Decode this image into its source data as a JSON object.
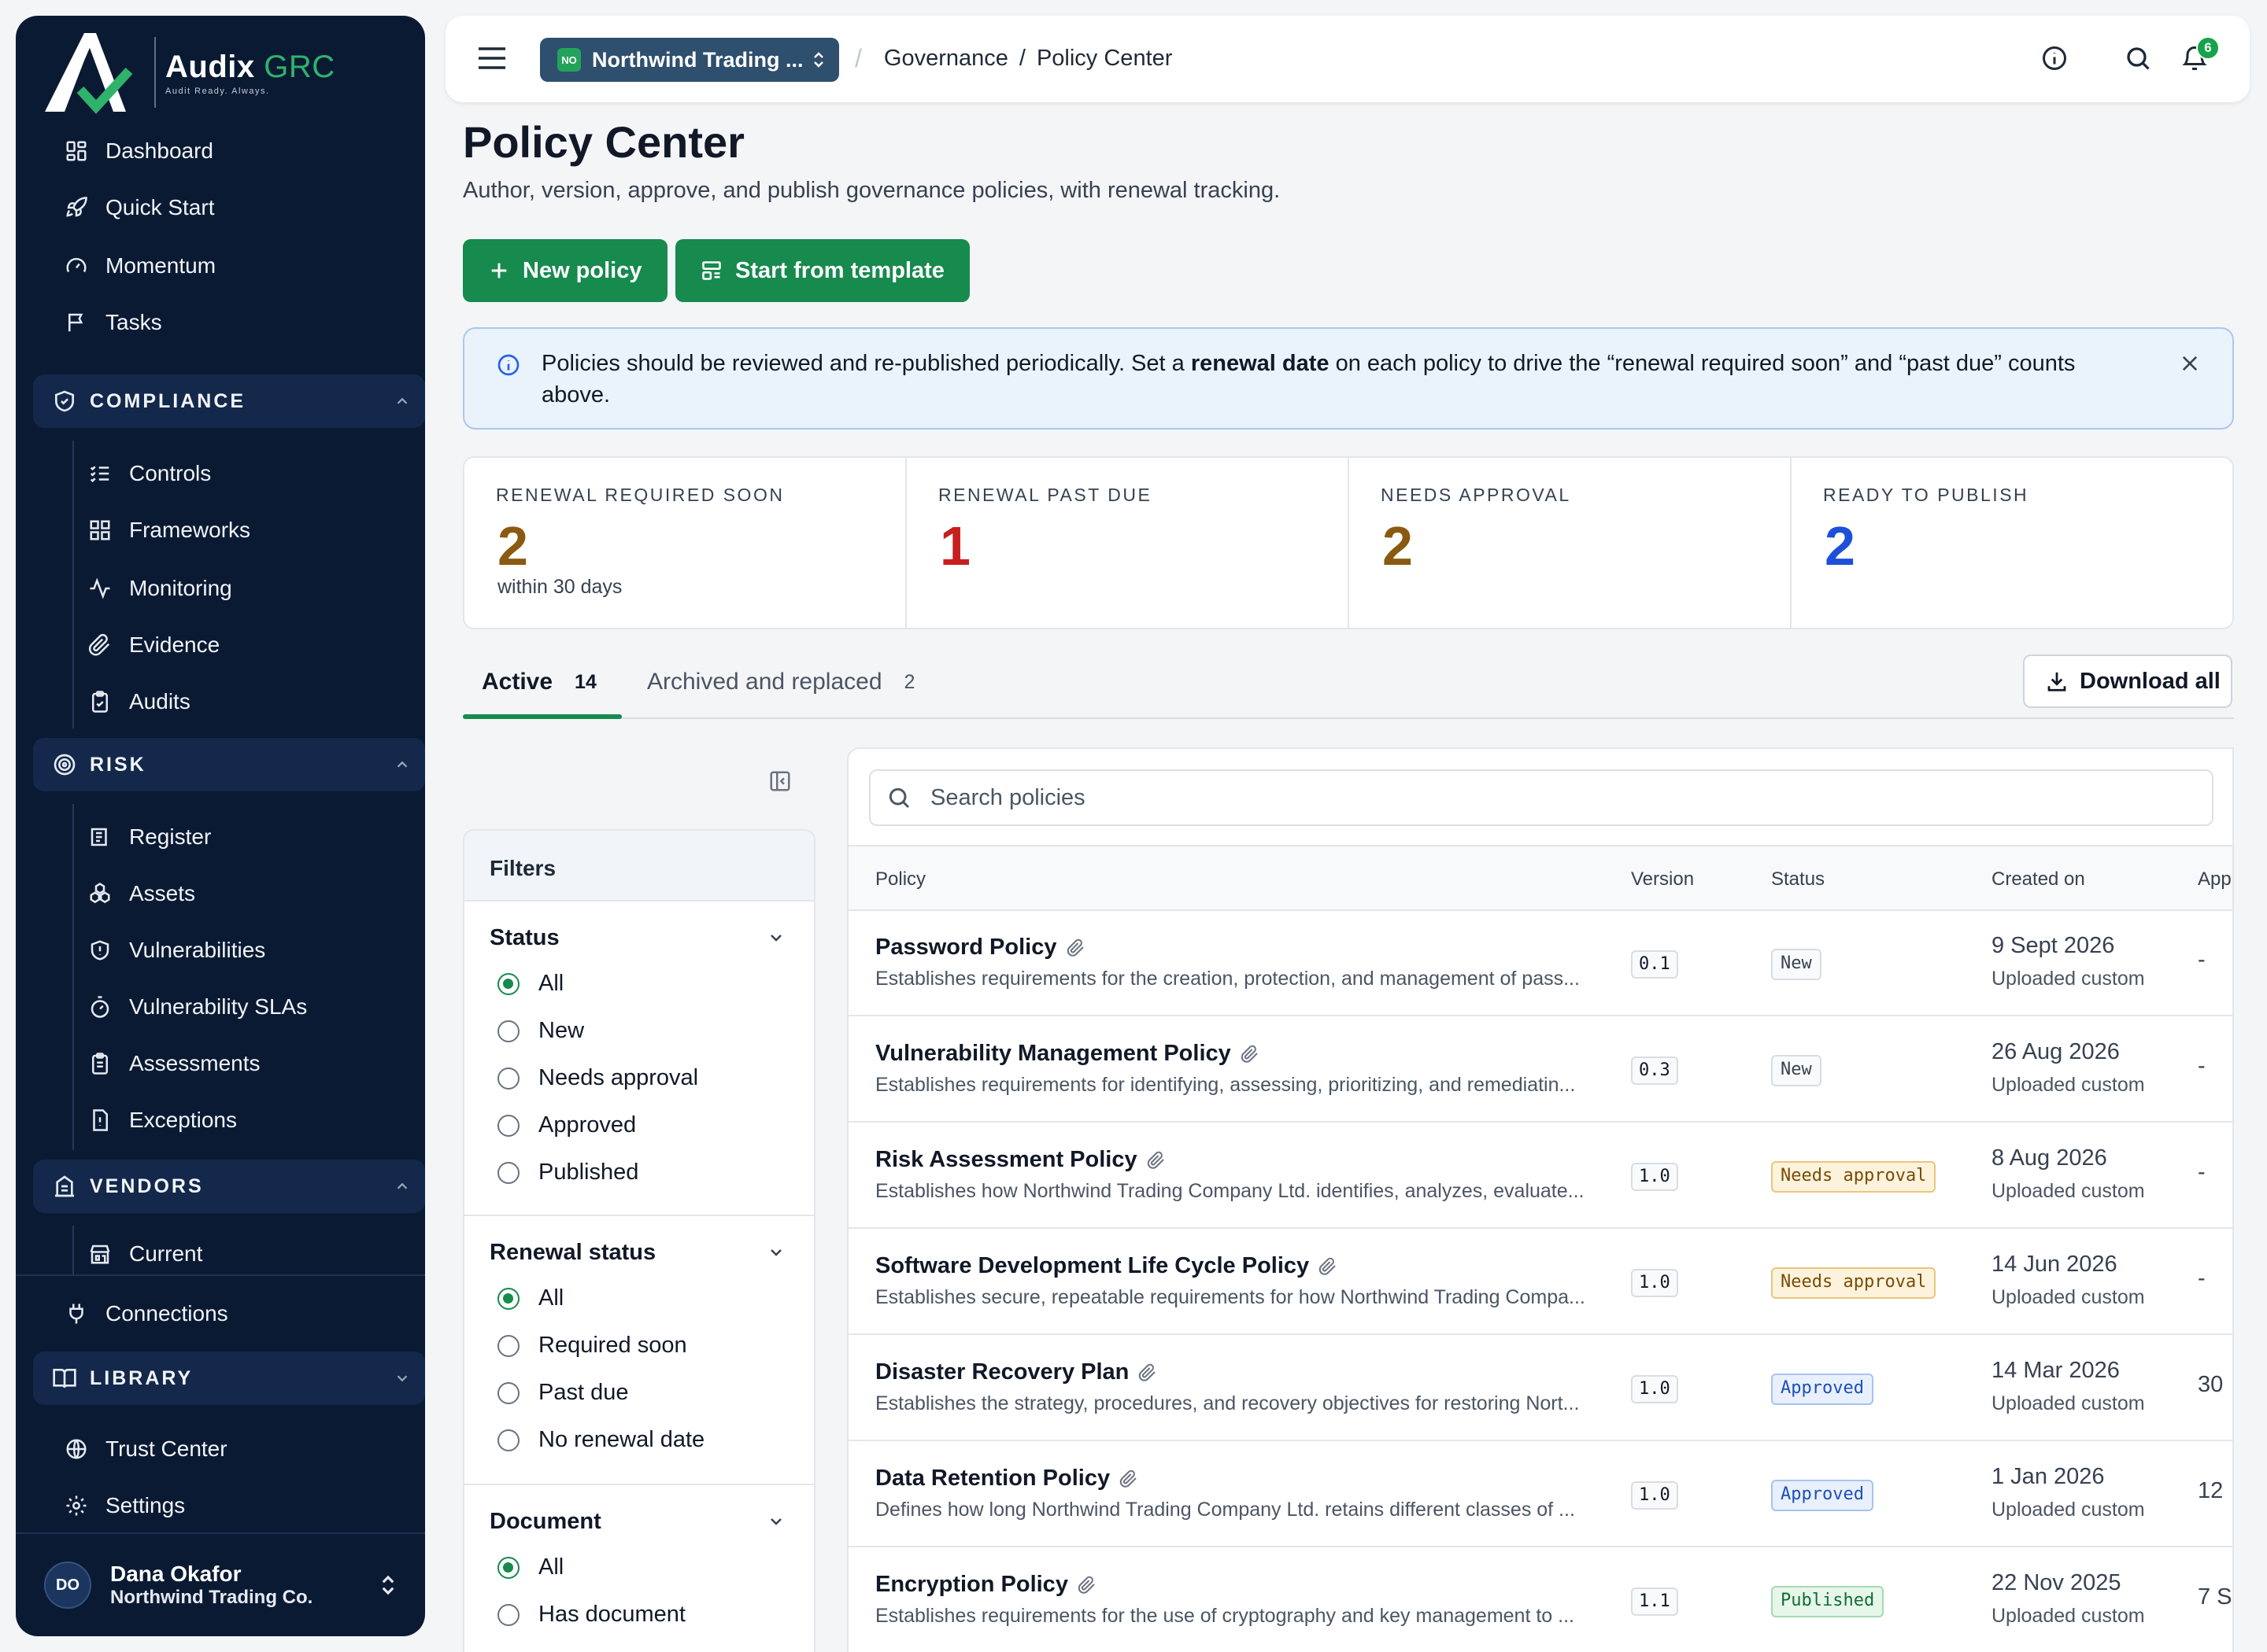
{
  "brand": {
    "name": "Audix",
    "accent": "GRC",
    "tagline": "Audit Ready. Always."
  },
  "sidebar": {
    "top": [
      "Dashboard",
      "Quick Start",
      "Momentum",
      "Tasks"
    ],
    "compliance": {
      "title": "COMPLIANCE",
      "items": [
        "Controls",
        "Frameworks",
        "Monitoring",
        "Evidence",
        "Audits"
      ]
    },
    "risk": {
      "title": "RISK",
      "items": [
        "Register",
        "Assets",
        "Vulnerabilities",
        "Vulnerability SLAs",
        "Assessments",
        "Exceptions"
      ]
    },
    "vendors": {
      "title": "VENDORS",
      "items": [
        "Current"
      ]
    },
    "connections": "Connections",
    "library": {
      "title": "LIBRARY"
    },
    "bottom": [
      "Trust Center",
      "Settings"
    ],
    "user": {
      "initials": "DO",
      "name": "Dana Okafor",
      "org": "Northwind Trading Co."
    }
  },
  "topbar": {
    "org_badge": "NO",
    "org_name": "Northwind Trading ...",
    "breadcrumb": [
      "Governance",
      "Policy Center"
    ],
    "notifications": "6"
  },
  "page": {
    "title": "Policy Center",
    "subtitle": "Author, version, approve, and publish governance policies, with renewal tracking.",
    "new_policy": "New policy",
    "template": "Start from template"
  },
  "alert": {
    "pre": "Policies should be reviewed and re-published periodically. Set a ",
    "bold": "renewal date",
    "post": " on each policy to drive the “renewal required soon” and “past due” counts above."
  },
  "stats": [
    {
      "label": "RENEWAL REQUIRED SOON",
      "value": "2",
      "sub": "within 30 days",
      "color": "#8a5a10"
    },
    {
      "label": "RENEWAL PAST DUE",
      "value": "1",
      "sub": "",
      "color": "#c81e1e"
    },
    {
      "label": "NEEDS APPROVAL",
      "value": "2",
      "sub": "",
      "color": "#8a5a10"
    },
    {
      "label": "READY TO PUBLISH",
      "value": "2",
      "sub": "",
      "color": "#1d4fd8"
    }
  ],
  "tabs": [
    {
      "label": "Active",
      "count": "14"
    },
    {
      "label": "Archived and replaced",
      "count": "2"
    }
  ],
  "download_all": "Download all",
  "filters": {
    "title": "Filters",
    "status": {
      "title": "Status",
      "options": [
        "All",
        "New",
        "Needs approval",
        "Approved",
        "Published"
      ]
    },
    "renewal": {
      "title": "Renewal status",
      "options": [
        "All",
        "Required soon",
        "Past due",
        "No renewal date"
      ]
    },
    "document": {
      "title": "Document",
      "options": [
        "All",
        "Has document"
      ]
    }
  },
  "search_placeholder": "Search policies",
  "table": {
    "columns": [
      "Policy",
      "Version",
      "Status",
      "Created on",
      "App"
    ],
    "rows": [
      {
        "name": "Password Policy",
        "desc": "Establishes requirements for the creation, protection, and management of pass...",
        "version": "0.1",
        "status": "New",
        "date": "9 Sept 2026",
        "source": "Uploaded custom",
        "app": "-"
      },
      {
        "name": "Vulnerability Management Policy",
        "desc": "Establishes requirements for identifying, assessing, prioritizing, and remediatin...",
        "version": "0.3",
        "status": "New",
        "date": "26 Aug 2026",
        "source": "Uploaded custom",
        "app": "-"
      },
      {
        "name": "Risk Assessment Policy",
        "desc": "Establishes how Northwind Trading Company Ltd. identifies, analyzes, evaluate...",
        "version": "1.0",
        "status": "Needs approval",
        "date": "8 Aug 2026",
        "source": "Uploaded custom",
        "app": "-"
      },
      {
        "name": "Software Development Life Cycle Policy",
        "desc": "Establishes secure, repeatable requirements for how Northwind Trading Compa...",
        "version": "1.0",
        "status": "Needs approval",
        "date": "14 Jun 2026",
        "source": "Uploaded custom",
        "app": "-"
      },
      {
        "name": "Disaster Recovery Plan",
        "desc": "Establishes the strategy, procedures, and recovery objectives for restoring Nort...",
        "version": "1.0",
        "status": "Approved",
        "date": "14 Mar 2026",
        "source": "Uploaded custom",
        "app": "30"
      },
      {
        "name": "Data Retention Policy",
        "desc": "Defines how long Northwind Trading Company Ltd. retains different classes of ...",
        "version": "1.0",
        "status": "Approved",
        "date": "1 Jan 2026",
        "source": "Uploaded custom",
        "app": "12"
      },
      {
        "name": "Encryption Policy",
        "desc": "Establishes requirements for the use of cryptography and key management to ...",
        "version": "1.1",
        "status": "Published",
        "date": "22 Nov 2025",
        "source": "Uploaded custom",
        "app": "7 S"
      }
    ]
  },
  "status_colors": {
    "New": {
      "bg": "#f8fafc",
      "border": "#d9dde2",
      "color": "#374151"
    },
    "Needs approval": {
      "bg": "#fdf3dc",
      "border": "#e9c67a",
      "color": "#7a4b06"
    },
    "Approved": {
      "bg": "#e8f0fd",
      "border": "#a9c2f0",
      "color": "#1d4fb8"
    },
    "Published": {
      "bg": "#e6f6ea",
      "border": "#a6d9b3",
      "color": "#146c33"
    }
  }
}
